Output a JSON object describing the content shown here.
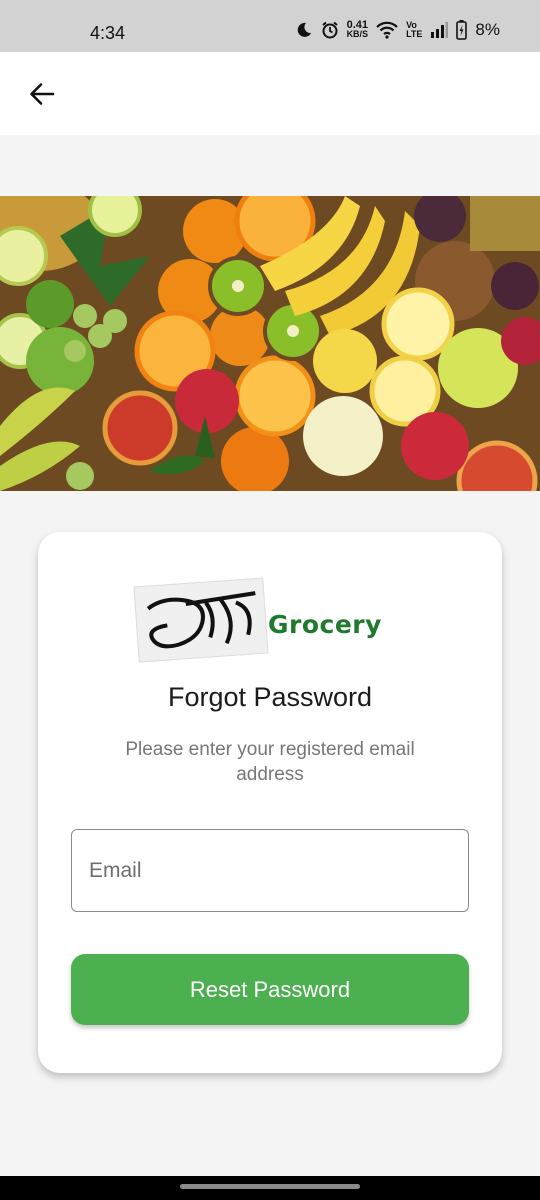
{
  "status_bar": {
    "time": "4:34",
    "network_speed_value": "0.41",
    "network_speed_unit": "KB/S",
    "lte_top": "Vo",
    "lte_bottom": "LTE",
    "battery_percent": "8%"
  },
  "app_bar": {
    "back_icon": "arrow-left-icon"
  },
  "hero": {
    "icon": "fruit-banner-image"
  },
  "card": {
    "logo_script": "हाम्रो",
    "logo_text": "Grocery",
    "title": "Forgot Password",
    "subtitle": "Please enter your registered email address",
    "email_placeholder": "Email",
    "email_value": "",
    "reset_label": "Reset Password"
  },
  "colors": {
    "accent": "#4caf50",
    "logo_green": "#1f7a2e",
    "background": "#f4f4f4"
  }
}
